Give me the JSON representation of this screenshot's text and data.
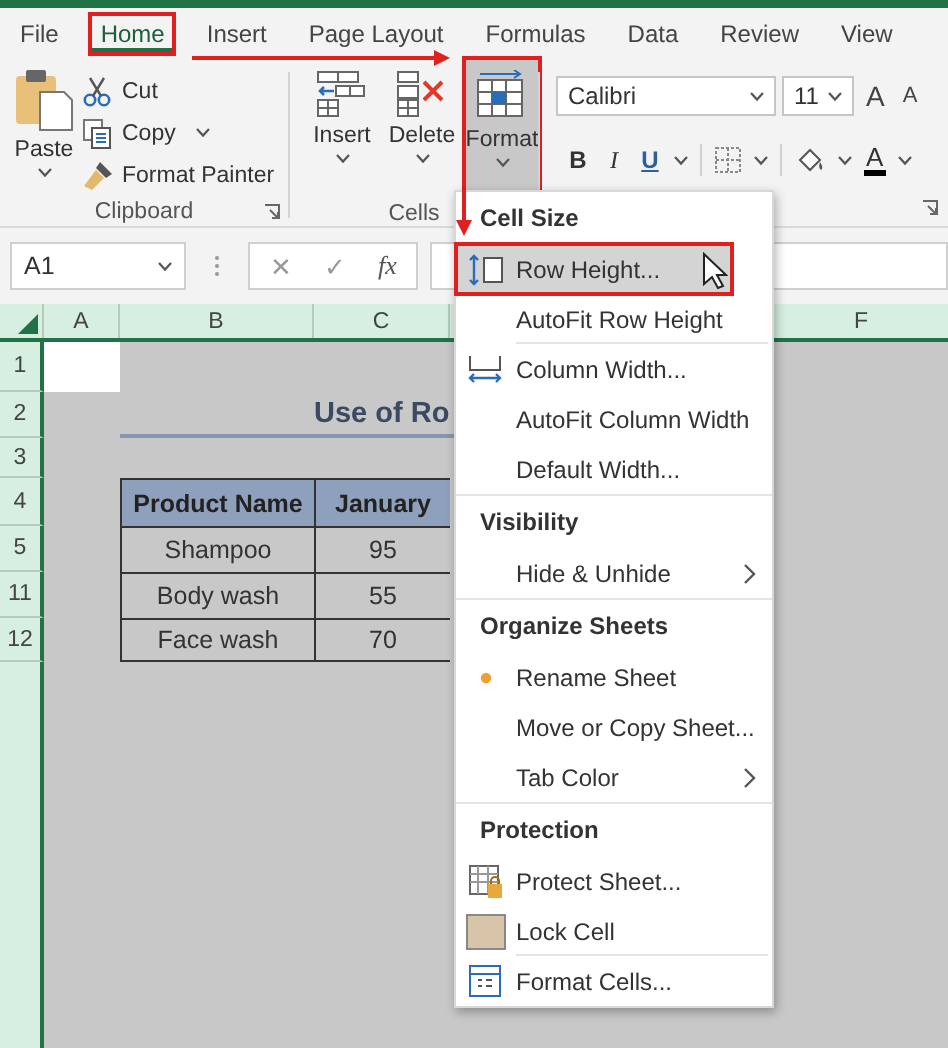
{
  "tabs": [
    {
      "label": "File",
      "selected": false,
      "callout": false
    },
    {
      "label": "Home",
      "selected": true,
      "callout": true
    },
    {
      "label": "Insert",
      "selected": false,
      "callout": false
    },
    {
      "label": "Page Layout",
      "selected": false,
      "callout": false
    },
    {
      "label": "Formulas",
      "selected": false,
      "callout": false
    },
    {
      "label": "Data",
      "selected": false,
      "callout": false
    },
    {
      "label": "Review",
      "selected": false,
      "callout": false
    },
    {
      "label": "View",
      "selected": false,
      "callout": false
    }
  ],
  "ribbon": {
    "clipboard": {
      "label": "Clipboard",
      "paste": "Paste",
      "items": [
        {
          "label": "Cut",
          "dropdown": false
        },
        {
          "label": "Copy",
          "dropdown": true
        },
        {
          "label": "Format Painter",
          "dropdown": false
        }
      ]
    },
    "cells": {
      "label": "Cells",
      "buttons": [
        {
          "label": "Insert",
          "selected": false,
          "callout": false
        },
        {
          "label": "Delete",
          "selected": false,
          "callout": false
        },
        {
          "label": "Format",
          "selected": true,
          "callout": true
        }
      ]
    },
    "font": {
      "font": "Calibri",
      "size": "11",
      "grow": "A",
      "shrink": "A",
      "styles": [
        {
          "label": "B",
          "kind": "bold"
        },
        {
          "label": "I",
          "kind": "italic"
        },
        {
          "label": "U",
          "kind": "underline"
        }
      ],
      "font_color": "A"
    }
  },
  "formula_bar": {
    "name_box": "A1",
    "cancel": "✕",
    "enter": "✓",
    "function": "fx"
  },
  "sheet": {
    "columns": [
      "A",
      "B",
      "C",
      "F"
    ],
    "rows": [
      "1",
      "2",
      "3",
      "4",
      "5",
      "11",
      "12"
    ],
    "title": "Use of Ro",
    "table": {
      "columns": [
        "Product Name",
        "January"
      ],
      "rows": [
        [
          "Shampoo",
          "95"
        ],
        [
          "Body wash",
          "55"
        ],
        [
          "Face wash",
          "70"
        ]
      ]
    }
  },
  "menu": {
    "sections": [
      {
        "heading": "Cell Size",
        "items": [
          {
            "label": "Row Height...",
            "highlighted": true,
            "callout": true,
            "cursor": true,
            "submenu": false,
            "separator_after": false
          },
          {
            "label": "AutoFit Row Height",
            "highlighted": false,
            "callout": false,
            "cursor": false,
            "submenu": false,
            "separator_after": true
          },
          {
            "label": "Column Width...",
            "highlighted": false,
            "callout": false,
            "cursor": false,
            "submenu": false,
            "separator_after": false
          },
          {
            "label": "AutoFit Column Width",
            "highlighted": false,
            "callout": false,
            "cursor": false,
            "submenu": false,
            "separator_after": false
          },
          {
            "label": "Default Width...",
            "highlighted": false,
            "callout": false,
            "cursor": false,
            "submenu": false,
            "separator_after": false
          }
        ]
      },
      {
        "heading": "Visibility",
        "items": [
          {
            "label": "Hide & Unhide",
            "highlighted": false,
            "callout": false,
            "cursor": false,
            "submenu": true,
            "separator_after": false
          }
        ]
      },
      {
        "heading": "Organize Sheets",
        "items": [
          {
            "label": "Rename Sheet",
            "highlighted": false,
            "callout": false,
            "cursor": false,
            "submenu": false,
            "separator_after": false
          },
          {
            "label": "Move or Copy Sheet...",
            "highlighted": false,
            "callout": false,
            "cursor": false,
            "submenu": false,
            "separator_after": false
          },
          {
            "label": "Tab Color",
            "highlighted": false,
            "callout": false,
            "cursor": false,
            "submenu": true,
            "separator_after": false
          }
        ]
      },
      {
        "heading": "Protection",
        "items": [
          {
            "label": "Protect Sheet...",
            "highlighted": false,
            "callout": false,
            "cursor": false,
            "submenu": false,
            "separator_after": false
          },
          {
            "label": "Lock Cell",
            "highlighted": false,
            "callout": false,
            "cursor": false,
            "submenu": false,
            "separator_after": true
          },
          {
            "label": "Format Cells...",
            "highlighted": false,
            "callout": false,
            "cursor": false,
            "submenu": false,
            "separator_after": false
          }
        ]
      }
    ]
  }
}
